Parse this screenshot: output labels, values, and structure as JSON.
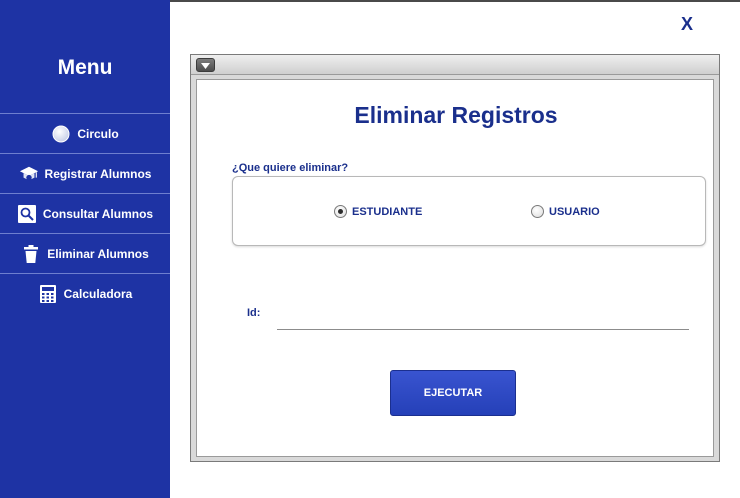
{
  "sidebar": {
    "title": "Menu",
    "items": [
      {
        "label": "Circulo",
        "icon": "circle-icon"
      },
      {
        "label": "Registrar Alumnos",
        "icon": "graduation-cap-icon"
      },
      {
        "label": "Consultar Alumnos",
        "icon": "search-icon"
      },
      {
        "label": "Eliminar Alumnos",
        "icon": "trash-icon"
      },
      {
        "label": "Calculadora",
        "icon": "calculator-icon"
      }
    ]
  },
  "window": {
    "close_label": "X"
  },
  "form": {
    "title": "Eliminar Registros",
    "question": "¿Que quiere eliminar?",
    "options": [
      {
        "label": "ESTUDIANTE",
        "selected": true
      },
      {
        "label": "USUARIO",
        "selected": false
      }
    ],
    "id_label": "Id:",
    "id_value": "",
    "execute_label": "EJECUTAR"
  },
  "colors": {
    "sidebar_bg": "#1e33a4",
    "accent_text": "#1a2f8c",
    "button_bg": "#2e49c4"
  }
}
